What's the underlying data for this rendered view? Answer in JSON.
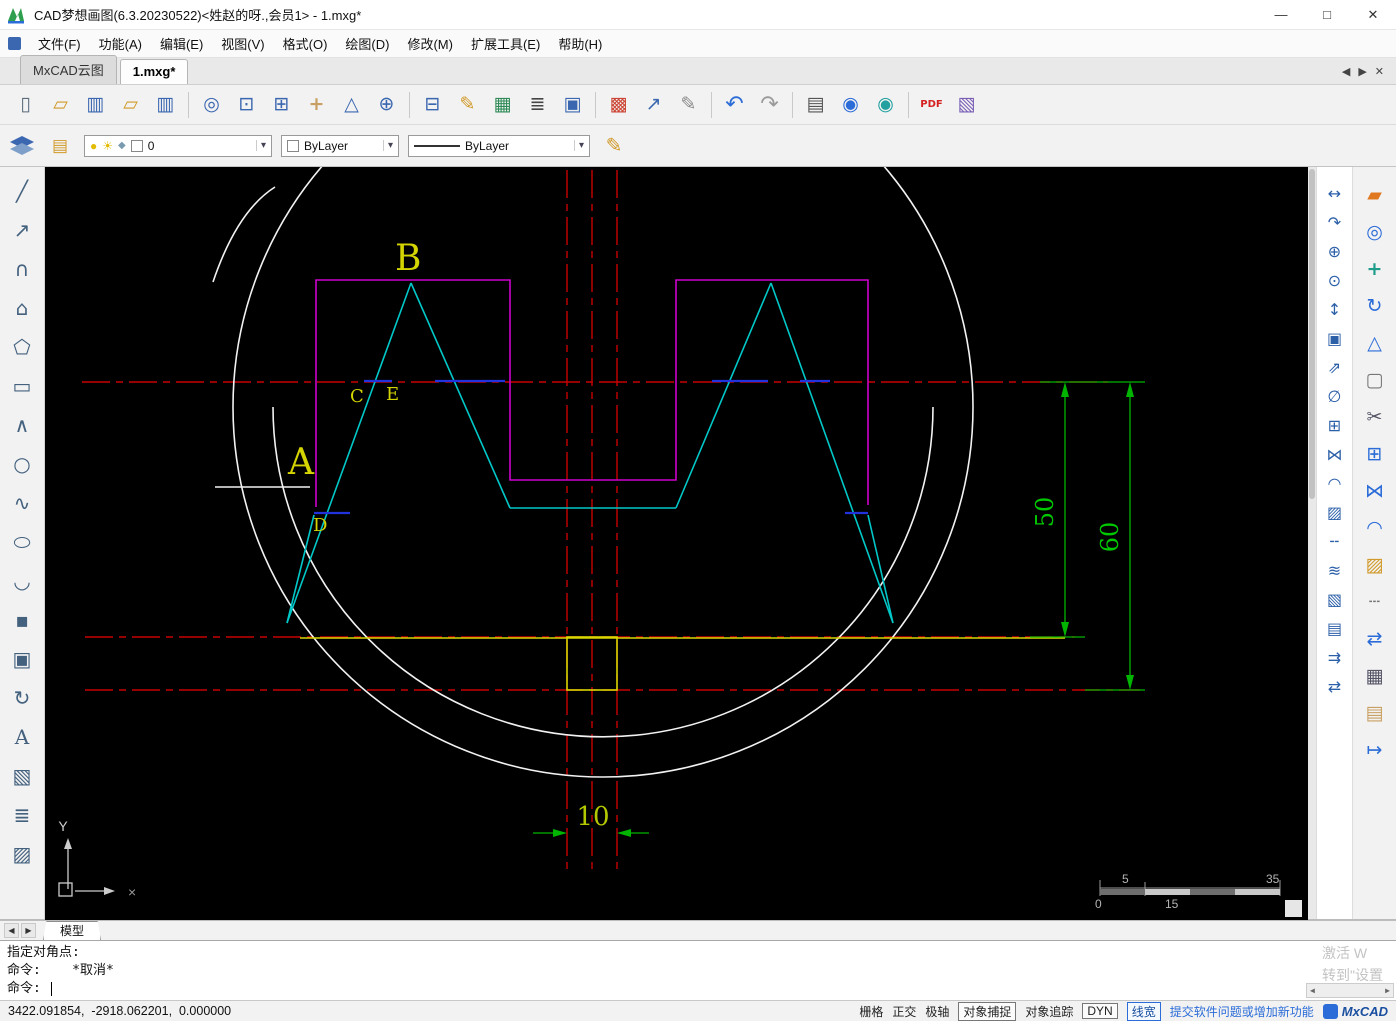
{
  "titlebar": {
    "title": "CAD梦想画图(6.3.20230522)<姓赵的呀.,会员1> - 1.mxg*",
    "minimize": "—",
    "maximize": "□",
    "close": "✕"
  },
  "menubar": {
    "items": [
      "文件(F)",
      "功能(A)",
      "编辑(E)",
      "视图(V)",
      "格式(O)",
      "绘图(D)",
      "修改(M)",
      "扩展工具(E)",
      "帮助(H)"
    ]
  },
  "tabbar": {
    "tabs": [
      "MxCAD云图",
      "1.mxg*"
    ],
    "prev": "◀",
    "next": "▶",
    "close": "✕"
  },
  "toolbar_main": {
    "items": [
      {
        "name": "new-file",
        "glyph": "▯"
      },
      {
        "name": "open-file",
        "glyph": "▱"
      },
      {
        "name": "save",
        "glyph": "▥"
      },
      {
        "name": "open-folder",
        "glyph": "▱"
      },
      {
        "name": "save-as",
        "glyph": "▥"
      },
      {
        "name": "zoom-all",
        "glyph": "◎"
      },
      {
        "name": "zoom-window",
        "glyph": "⊡"
      },
      {
        "name": "zoom-extents",
        "glyph": "⊞"
      },
      {
        "name": "pan",
        "glyph": "+"
      },
      {
        "name": "zoom-scale",
        "glyph": "△"
      },
      {
        "name": "zoom-in",
        "glyph": "⊕"
      },
      {
        "name": "zoom-previous",
        "glyph": "⊟"
      },
      {
        "name": "draw-pencil",
        "glyph": "✎"
      },
      {
        "name": "insert-table",
        "glyph": "▦"
      },
      {
        "name": "text-style",
        "glyph": "≣"
      },
      {
        "name": "copy-clipboard",
        "glyph": "▣"
      },
      {
        "name": "color-table",
        "glyph": "▩"
      },
      {
        "name": "export-view",
        "glyph": "↗"
      },
      {
        "name": "edit-attributes",
        "glyph": "✎"
      },
      {
        "name": "undo",
        "glyph": "↶"
      },
      {
        "name": "redo",
        "glyph": "↷"
      },
      {
        "name": "print",
        "glyph": "▤"
      },
      {
        "name": "publish-web",
        "glyph": "◉"
      },
      {
        "name": "open-web",
        "glyph": "◉"
      },
      {
        "name": "export-pdf",
        "glyph": "PDF"
      },
      {
        "name": "export-image",
        "glyph": "▧"
      }
    ]
  },
  "toolbar_props": {
    "bulb": "●",
    "sun": "☀",
    "freeze": "◆",
    "layer_value": "0",
    "color_value": "ByLayer",
    "linetype_value": "ByLayer",
    "arrow": "▾",
    "pencil": "✎"
  },
  "left_toolbar": {
    "items": [
      {
        "name": "line",
        "glyph": "╱"
      },
      {
        "name": "construction-line",
        "glyph": "↗"
      },
      {
        "name": "arc",
        "glyph": "∩"
      },
      {
        "name": "polygon",
        "glyph": "⌂"
      },
      {
        "name": "polygon-inscribed",
        "glyph": "⬠"
      },
      {
        "name": "rectangle",
        "glyph": "▭"
      },
      {
        "name": "polyline",
        "glyph": "∧"
      },
      {
        "name": "circle",
        "glyph": "○"
      },
      {
        "name": "spline",
        "glyph": "∿"
      },
      {
        "name": "ellipse",
        "glyph": "⬭"
      },
      {
        "name": "ellipse-arc",
        "glyph": "◡"
      },
      {
        "name": "point",
        "glyph": "▪"
      },
      {
        "name": "block-insert",
        "glyph": "▣"
      },
      {
        "name": "rotate-tool",
        "glyph": "↻"
      },
      {
        "name": "text",
        "glyph": "A"
      },
      {
        "name": "image-insert",
        "glyph": "▧"
      },
      {
        "name": "mtext",
        "glyph": "≣"
      },
      {
        "name": "hatch",
        "glyph": "▨"
      }
    ]
  },
  "right_dim_toolbar": {
    "items": [
      {
        "name": "dim-linear",
        "glyph": "↔"
      },
      {
        "name": "dim-arc-length",
        "glyph": "↷"
      },
      {
        "name": "pan-tool",
        "glyph": "⊕"
      },
      {
        "name": "zoom-tool",
        "glyph": "⊙"
      },
      {
        "name": "dim-ordinate",
        "glyph": "↕"
      },
      {
        "name": "zoom-window-tool",
        "glyph": "▣"
      },
      {
        "name": "dim-aligned",
        "glyph": "⇗"
      },
      {
        "name": "dim-diameter",
        "glyph": "∅"
      },
      {
        "name": "array-tool",
        "glyph": "⊞"
      },
      {
        "name": "mirror-tool",
        "glyph": "⋈"
      },
      {
        "name": "fillet-tool",
        "glyph": "◠"
      },
      {
        "name": "hatch-tool",
        "glyph": "▨"
      },
      {
        "name": "linetype-tool",
        "glyph": "╌"
      },
      {
        "name": "offset-tool",
        "glyph": "≋"
      },
      {
        "name": "view-3d",
        "glyph": "▧"
      },
      {
        "name": "paste-tool",
        "glyph": "▤"
      },
      {
        "name": "align-tool",
        "glyph": "⇉"
      },
      {
        "name": "swap-tool",
        "glyph": "⇄"
      }
    ]
  },
  "right_modify_toolbar": {
    "items": [
      {
        "name": "erase",
        "glyph": "▰"
      },
      {
        "name": "copy",
        "glyph": "◎"
      },
      {
        "name": "move",
        "glyph": "+"
      },
      {
        "name": "rotate",
        "glyph": "↻"
      },
      {
        "name": "scale",
        "glyph": "△"
      },
      {
        "name": "stretch",
        "glyph": "▢"
      },
      {
        "name": "trim",
        "glyph": "✂"
      },
      {
        "name": "array",
        "glyph": "⊞"
      },
      {
        "name": "mirror",
        "glyph": "⋈"
      },
      {
        "name": "fillet",
        "glyph": "◠"
      },
      {
        "name": "gradient-fill",
        "glyph": "▨"
      },
      {
        "name": "break",
        "glyph": "┄"
      },
      {
        "name": "lengthen",
        "glyph": "⇄"
      },
      {
        "name": "solid-3d",
        "glyph": "▦"
      },
      {
        "name": "paste-clipboard",
        "glyph": "▤"
      },
      {
        "name": "align-arrows",
        "glyph": "↦"
      }
    ]
  },
  "drawing": {
    "labels": {
      "B": "B",
      "C": "C",
      "E": "E",
      "A": "A",
      "D": "D"
    },
    "dims": {
      "d50": "50",
      "d60": "60",
      "d10": "10"
    },
    "scale_bar": {
      "t1": "5",
      "t2": "35",
      "b1": "0",
      "b2": "15"
    },
    "ucs_y": "Y",
    "ucs_cross": "×"
  },
  "modelbar": {
    "prev": "◀",
    "next": "▶",
    "tab": "模型"
  },
  "command": {
    "lines": [
      "指定对角点:",
      "命令:    *取消*",
      "命令: "
    ],
    "watermark_line1": "激活 W",
    "watermark_line2": "转到\"设置",
    "scroll_left": "◀",
    "scroll_right": "▶"
  },
  "statusbar": {
    "coords": "3422.091854,  -2918.062201,  0.000000",
    "toggles": [
      "栅格",
      "正交",
      "极轴",
      "对象捕捉",
      "对象追踪",
      "DYN",
      "线宽"
    ],
    "link": "提交软件问题或增加新功能",
    "brand": "MxCAD"
  }
}
